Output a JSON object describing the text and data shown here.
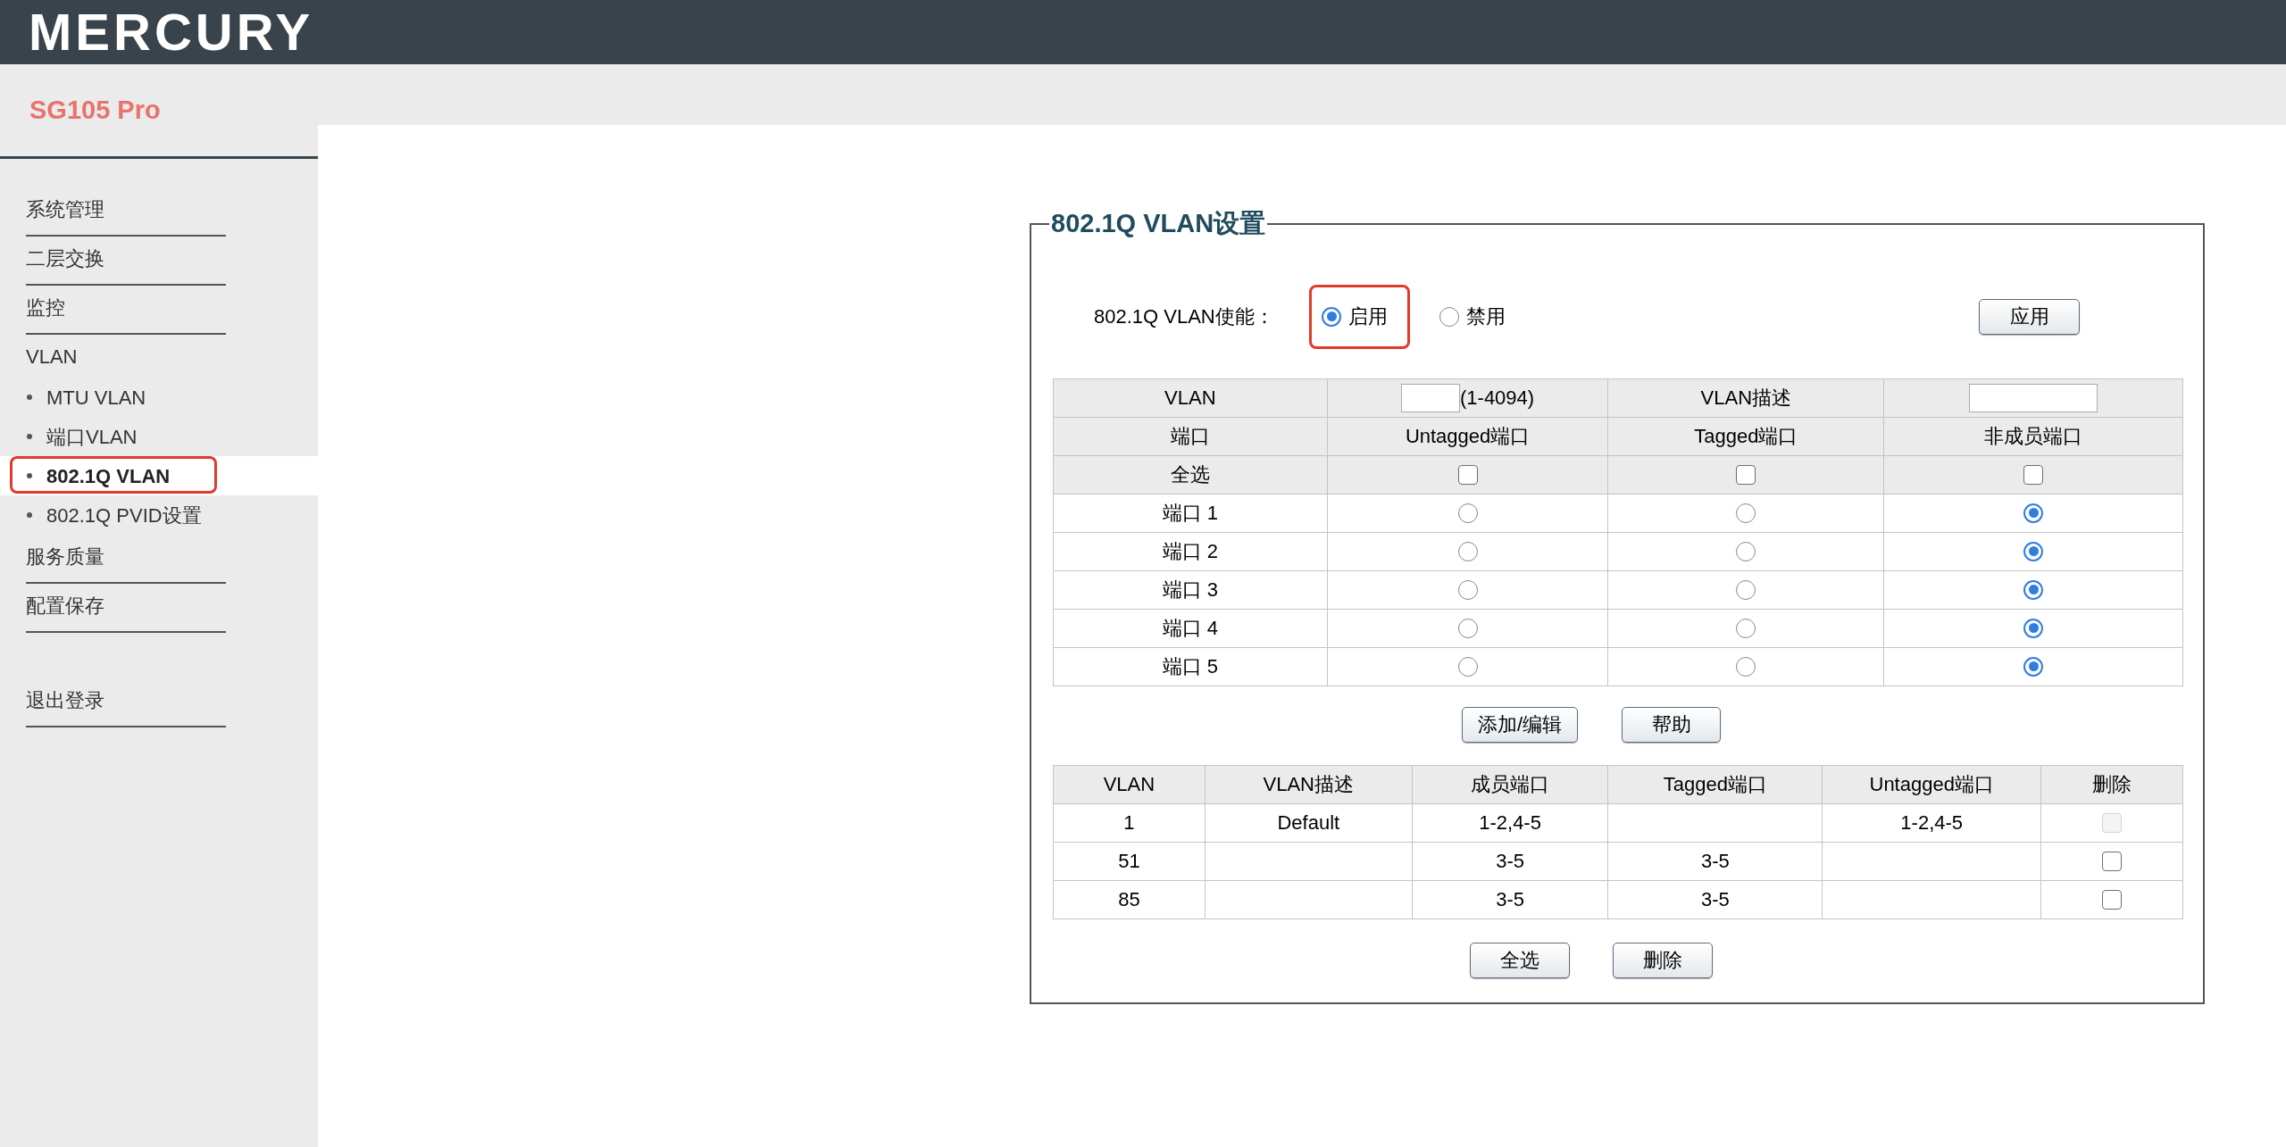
{
  "header": {
    "logo": "MERCURY"
  },
  "sidebar": {
    "model": "SG105 Pro",
    "items": [
      {
        "label": "系统管理",
        "kind": "section",
        "selected": false
      },
      {
        "label": "二层交换",
        "kind": "section",
        "selected": false
      },
      {
        "label": "监控",
        "kind": "section",
        "selected": false
      },
      {
        "label": "VLAN",
        "kind": "group",
        "selected": false
      },
      {
        "label": "MTU VLAN",
        "kind": "sub",
        "selected": false
      },
      {
        "label": "端口VLAN",
        "kind": "sub",
        "selected": false
      },
      {
        "label": "802.1Q VLAN",
        "kind": "sub",
        "selected": true
      },
      {
        "label": "802.1Q PVID设置",
        "kind": "sub",
        "selected": false
      },
      {
        "label": "服务质量",
        "kind": "section",
        "selected": false
      },
      {
        "label": "配置保存",
        "kind": "section",
        "selected": false
      },
      {
        "label": "退出登录",
        "kind": "logout",
        "selected": false
      }
    ]
  },
  "panel": {
    "title": "802.1Q VLAN设置",
    "enable": {
      "label": "802.1Q VLAN使能：",
      "highlighted": true,
      "options": [
        {
          "label": "启用",
          "selected": true
        },
        {
          "label": "禁用",
          "selected": false
        }
      ],
      "apply": "应用"
    },
    "config_table": {
      "vlan_label": "VLAN",
      "vlan_range": "(1-4094)",
      "desc_label": "VLAN描述",
      "columns": [
        "端口",
        "Untagged端口",
        "Tagged端口",
        "非成员端口"
      ],
      "select_all": {
        "label": "全选",
        "checks": [
          {
            "checked": false
          },
          {
            "checked": false
          },
          {
            "checked": false
          }
        ]
      },
      "ports": [
        {
          "label": "端口 1",
          "options": [
            {
              "selected": false
            },
            {
              "selected": false
            },
            {
              "selected": true
            }
          ]
        },
        {
          "label": "端口 2",
          "options": [
            {
              "selected": false
            },
            {
              "selected": false
            },
            {
              "selected": true
            }
          ]
        },
        {
          "label": "端口 3",
          "options": [
            {
              "selected": false
            },
            {
              "selected": false
            },
            {
              "selected": true
            }
          ]
        },
        {
          "label": "端口 4",
          "options": [
            {
              "selected": false
            },
            {
              "selected": false
            },
            {
              "selected": true
            }
          ]
        },
        {
          "label": "端口 5",
          "options": [
            {
              "selected": false
            },
            {
              "selected": false
            },
            {
              "selected": true
            }
          ]
        }
      ]
    },
    "buttons": [
      "添加/编辑",
      "帮助"
    ],
    "vlan_table": {
      "columns": [
        "VLAN",
        "VLAN描述",
        "成员端口",
        "Tagged端口",
        "Untagged端口",
        "删除"
      ],
      "rows": [
        {
          "vlan": "1",
          "description": "Default",
          "members": "1-2,4-5",
          "untagged": "1-2,4-5",
          "checked": false,
          "disabled": true
        },
        {
          "vlan": "51",
          "members": "3-5",
          "tagged": "3-5",
          "checked": false,
          "disabled": false
        },
        {
          "vlan": "85",
          "members": "3-5",
          "tagged": "3-5",
          "checked": false,
          "disabled": false
        }
      ]
    },
    "footer_buttons": [
      "全选",
      "删除"
    ]
  }
}
